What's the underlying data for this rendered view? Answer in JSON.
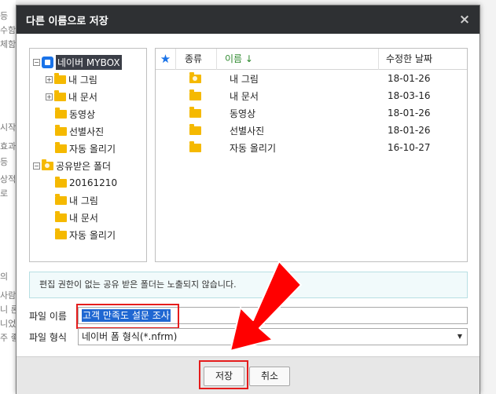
{
  "background": {
    "fragments": [
      "등",
      "수함",
      "체함",
      "시작",
      "효과",
      "등",
      "상적",
      "로",
      "의",
      "사람",
      "니 론",
      "니었",
      "주 좋"
    ]
  },
  "dialog": {
    "title": "다른 이름으로 저장",
    "close_symbol": "×"
  },
  "tree": {
    "root": {
      "label": "네이버 MYBOX",
      "toggle": "−"
    },
    "root_children": [
      {
        "label": "내 그림",
        "toggle": "+"
      },
      {
        "label": "내 문서",
        "toggle": "+"
      },
      {
        "label": "동영상",
        "toggle": ""
      },
      {
        "label": "선별사진",
        "toggle": ""
      },
      {
        "label": "자동 올리기",
        "toggle": ""
      }
    ],
    "shared": {
      "label": "공유받은 폴더",
      "toggle": "−"
    },
    "shared_children": [
      {
        "label": "20161210"
      },
      {
        "label": "내 그림"
      },
      {
        "label": "내 문서"
      },
      {
        "label": "자동 올리기"
      }
    ]
  },
  "file_list": {
    "star_symbol": "★",
    "headers": {
      "type": "종류",
      "name": "이름 ↓",
      "date": "수정한 날짜"
    },
    "rows": [
      {
        "name": "내 그림",
        "date": "18-01-26",
        "shared": true
      },
      {
        "name": "내 문서",
        "date": "18-03-16",
        "shared": false
      },
      {
        "name": "동영상",
        "date": "18-01-26",
        "shared": false
      },
      {
        "name": "선별사진",
        "date": "18-01-26",
        "shared": false
      },
      {
        "name": "자동 올리기",
        "date": "16-10-27",
        "shared": false
      }
    ]
  },
  "notice": "편집 권한이 없는 공유 받은 폴더는 노출되지 않습니다.",
  "filename": {
    "label": "파일 이름",
    "value": "고객 만족도 설문 조사"
  },
  "format": {
    "label": "파일 형식",
    "value": "네이버 폼 형식(*.nfrm)",
    "caret": "▼"
  },
  "buttons": {
    "save": "저장",
    "cancel": "취소"
  },
  "colors": {
    "highlight": "#e51c1c",
    "accent": "#1a73e8",
    "titlebar": "#2e3033"
  }
}
